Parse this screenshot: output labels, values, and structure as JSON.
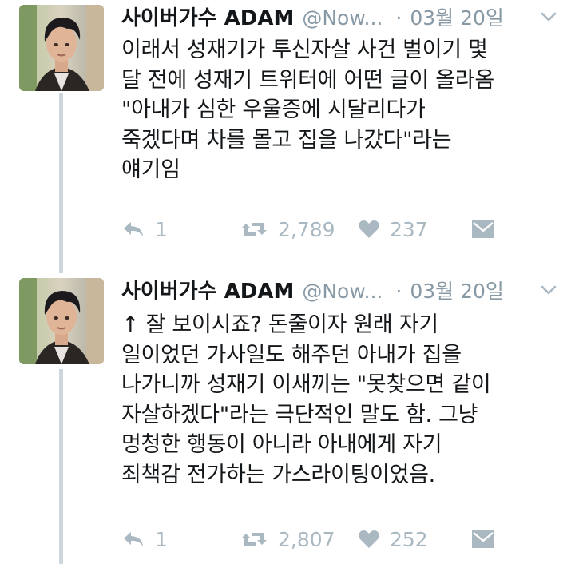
{
  "tweets": [
    {
      "name": "사이버가수 ADAM",
      "handle": "@Now...",
      "separator": "·",
      "date": "03월 20일",
      "text": "이래서 성재기가 투신자살 사건 벌이기 몇\n달 전에 성재기 트위터에 어떤 글이 올라옴\n\"아내가 심한 우울증에 시달리다가\n죽겠다며 차를 몰고 집을 나갔다\"라는\n얘기임",
      "reply_count": "1",
      "retweet_count": "2,789",
      "like_count": "237",
      "icons": {
        "reply": "reply-icon",
        "retweet": "retweet-icon",
        "like": "heart-icon",
        "dm": "direct-message-icon",
        "caret": "chevron-down-icon"
      }
    },
    {
      "name": "사이버가수 ADAM",
      "handle": "@Now...",
      "separator": "·",
      "date": "03월 20일",
      "text": "↑ 잘 보이시죠? 돈줄이자 원래 자기\n일이었던 가사일도 해주던 아내가 집을\n나가니까 성재기 이새끼는 \"못찾으면 같이\n자살하겠다\"라는 극단적인 말도 함. 그냥\n멍청한 행동이 아니라 아내에게 자기\n죄책감 전가하는 가스라이팅이었음.",
      "reply_count": "1",
      "retweet_count": "2,807",
      "like_count": "252",
      "icons": {
        "reply": "reply-icon",
        "retweet": "retweet-icon",
        "like": "heart-icon",
        "dm": "direct-message-icon",
        "caret": "chevron-down-icon"
      }
    }
  ],
  "colors": {
    "text": "#14171a",
    "muted": "#8899a6",
    "action": "#aab8c2",
    "thread_line": "#ccd6dd"
  }
}
